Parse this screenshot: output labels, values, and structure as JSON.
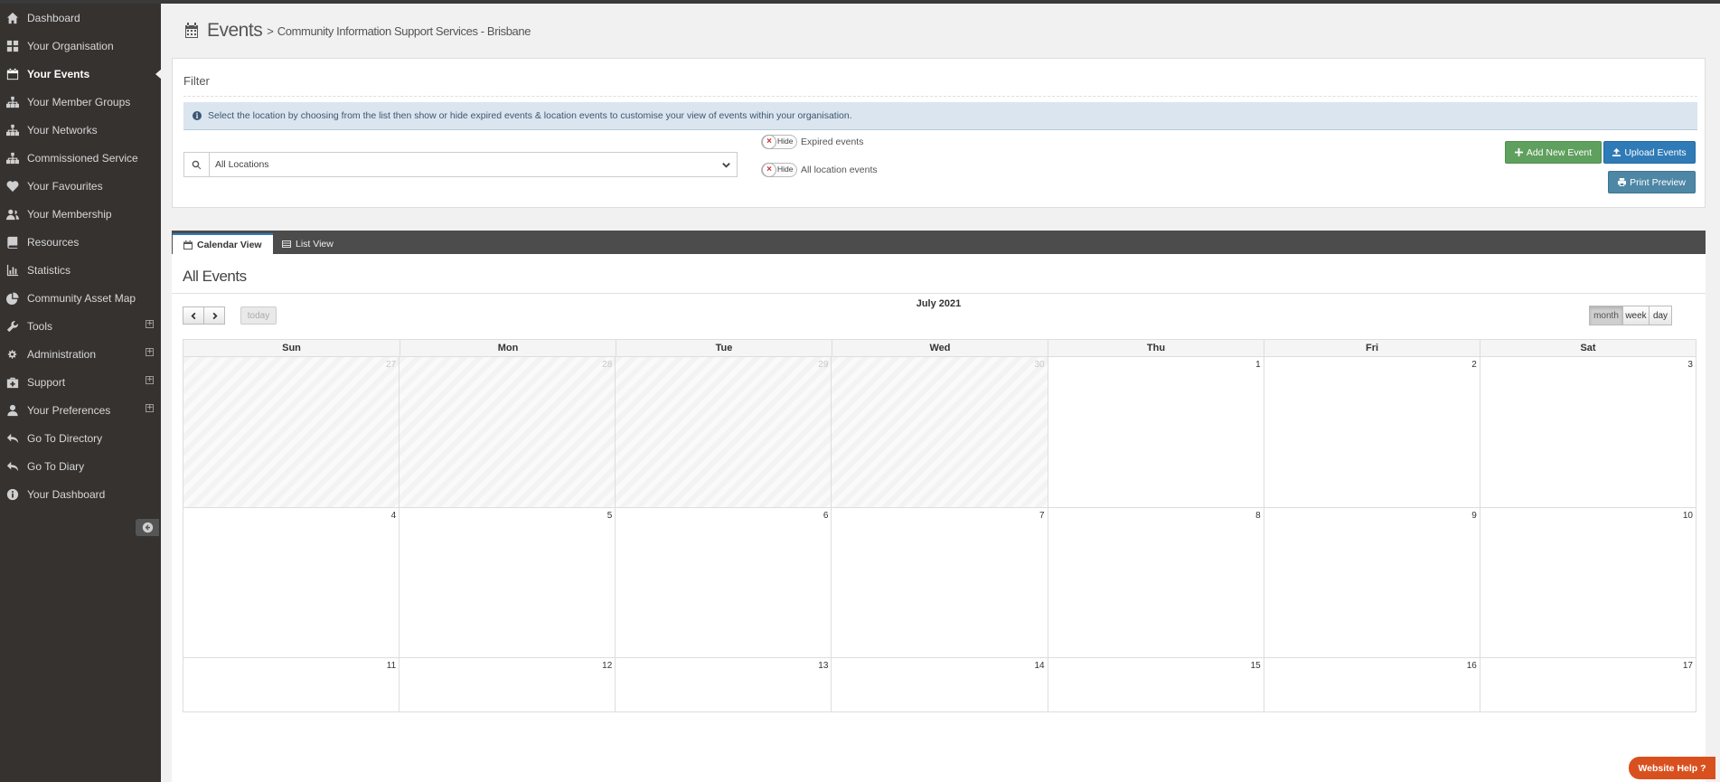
{
  "sidebar": {
    "items": [
      {
        "label": "Dashboard",
        "icon": "home-icon"
      },
      {
        "label": "Your Organisation",
        "icon": "grid-icon"
      },
      {
        "label": "Your Events",
        "icon": "calendar-icon"
      },
      {
        "label": "Your Member Groups",
        "icon": "sitemap-icon"
      },
      {
        "label": "Your Networks",
        "icon": "sitemap-icon"
      },
      {
        "label": "Commissioned Service",
        "icon": "sitemap-icon"
      },
      {
        "label": "Your Favourites",
        "icon": "heart-icon"
      },
      {
        "label": "Your Membership",
        "icon": "users-icon"
      },
      {
        "label": "Resources",
        "icon": "book-icon"
      },
      {
        "label": "Statistics",
        "icon": "bar-chart-icon"
      },
      {
        "label": "Community Asset Map",
        "icon": "pie-chart-icon"
      },
      {
        "label": "Tools",
        "icon": "wrench-icon"
      },
      {
        "label": "Administration",
        "icon": "cogs-icon"
      },
      {
        "label": "Support",
        "icon": "medkit-icon"
      },
      {
        "label": "Your Preferences",
        "icon": "user-icon"
      },
      {
        "label": "Go To Directory",
        "icon": "reply-icon"
      },
      {
        "label": "Go To Diary",
        "icon": "reply-icon"
      },
      {
        "label": "Your Dashboard",
        "icon": "info-icon"
      }
    ],
    "expand_symbol": "+"
  },
  "header": {
    "title": "Events",
    "separator": ">",
    "subtitle": "Community Information Support Services - Brisbane"
  },
  "filter": {
    "title": "Filter",
    "info": "Select the location by choosing from the list then show or hide expired events & location events to customise your view of events within your organisation.",
    "location_value": "All Locations",
    "toggles": [
      {
        "state": "Hide",
        "label": "Expired events"
      },
      {
        "state": "Hide",
        "label": "All location events"
      }
    ],
    "buttons": {
      "add": "Add New Event",
      "upload": "Upload Events",
      "print": "Print Preview"
    }
  },
  "tabs": [
    {
      "label": "Calendar View"
    },
    {
      "label": "List View"
    }
  ],
  "calendar": {
    "heading": "All Events",
    "title": "July 2021",
    "today_label": "today",
    "views": [
      "month",
      "week",
      "day"
    ],
    "active_view": "month",
    "weekdays": [
      "Sun",
      "Mon",
      "Tue",
      "Wed",
      "Thu",
      "Fri",
      "Sat"
    ],
    "weeks": [
      [
        {
          "d": "27",
          "other": true
        },
        {
          "d": "28",
          "other": true
        },
        {
          "d": "29",
          "other": true
        },
        {
          "d": "30",
          "other": true
        },
        {
          "d": "1"
        },
        {
          "d": "2"
        },
        {
          "d": "3"
        }
      ],
      [
        {
          "d": "4"
        },
        {
          "d": "5"
        },
        {
          "d": "6"
        },
        {
          "d": "7"
        },
        {
          "d": "8"
        },
        {
          "d": "9"
        },
        {
          "d": "10"
        }
      ],
      [
        {
          "d": "11"
        },
        {
          "d": "12"
        },
        {
          "d": "13"
        },
        {
          "d": "14"
        },
        {
          "d": "15"
        },
        {
          "d": "16"
        },
        {
          "d": "17"
        }
      ]
    ]
  },
  "help": {
    "label": "Website Help ?"
  },
  "colors": {
    "sidebar_bg": "#353230",
    "tab_bar": "#4c4c4c",
    "add_button": "#5fa05f",
    "upload_button": "#2f7bb7",
    "print_button": "#4e87a5",
    "info_bg": "#dbe5ef",
    "help_button": "#d9501f"
  }
}
